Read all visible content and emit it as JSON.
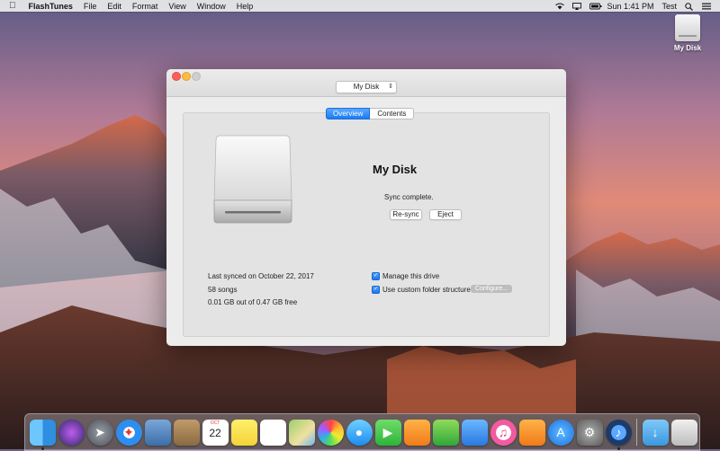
{
  "menubar": {
    "app_name": "FlashTunes",
    "menus": [
      "File",
      "Edit",
      "Format",
      "View",
      "Window",
      "Help"
    ],
    "clock": "Sun 1:41 PM",
    "user": "Test"
  },
  "desktop": {
    "disk_label": "My Disk"
  },
  "window": {
    "disk_select": "My Disk",
    "tabs": [
      {
        "label": "Overview",
        "selected": true
      },
      {
        "label": "Contents",
        "selected": false
      }
    ],
    "disk_name": "My Disk",
    "sync_status": "Sync complete.",
    "resync_label": "Re-sync",
    "eject_label": "Eject",
    "last_synced": "Last synced on October 22, 2017",
    "song_count": "58 songs",
    "capacity": "0.01 GB out of 0.47 GB free",
    "manage_drive_label": "Manage this drive",
    "manage_drive_checked": true,
    "custom_folder_label": "Use custom folder structure",
    "custom_folder_checked": true,
    "configure_label": "Configure..."
  },
  "dock": {
    "calendar_day": "22",
    "calendar_month": "OCT",
    "items": [
      "finder",
      "siri",
      "launchpad",
      "safari",
      "photo-viewer",
      "contacts",
      "calendar",
      "notes",
      "reminders",
      "maps",
      "photos",
      "messages",
      "facetime",
      "pages",
      "numbers",
      "keynote",
      "itunes",
      "ibooks",
      "app-store",
      "system-preferences",
      "flashtunes",
      "downloads",
      "trash"
    ]
  }
}
